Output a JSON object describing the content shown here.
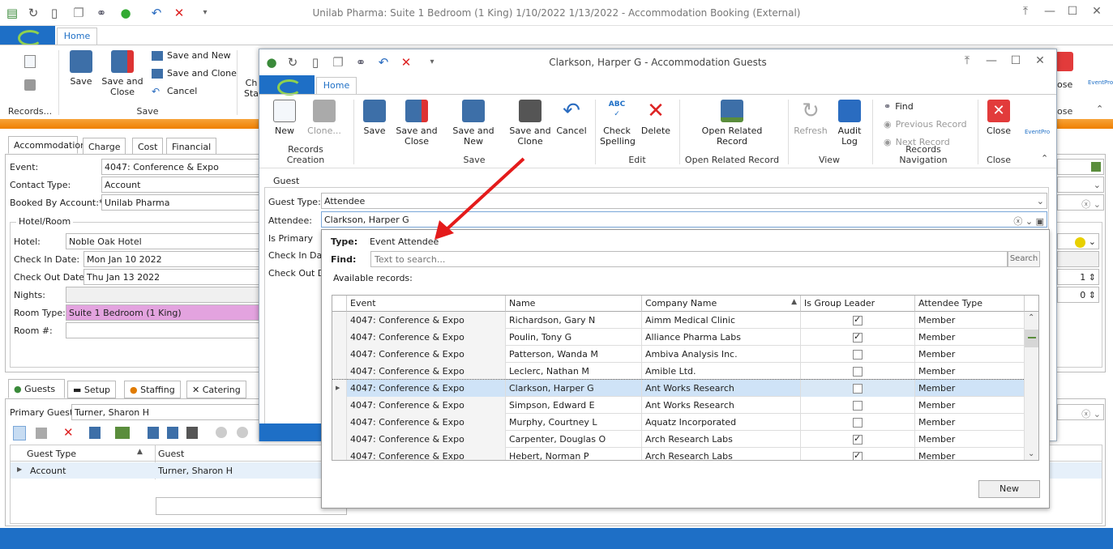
{
  "main_window": {
    "title": "Unilab Pharma: Suite 1 Bedroom (1 King) 1/10/2022 1/13/2022  - Accommodation Booking (External)",
    "home_tab": "Home"
  },
  "main_ribbon": {
    "save": "Save",
    "save_and_close": "Save and Close",
    "save_and_new": "Save and New",
    "save_and_clone": "Save and Clone",
    "cancel": "Cancel",
    "group_records": "Records...",
    "group_save": "Save",
    "partial_left": "Ch Sta",
    "partial_close": "ose",
    "partial_close_group": "ose",
    "partial_logo": "EventPro"
  },
  "booking_tabs": [
    "Accommodation",
    "Charge",
    "Cost",
    "Financial"
  ],
  "booking": {
    "event_label": "Event:",
    "event_value": "4047: Conference & Expo",
    "contact_type_label": "Contact Type:",
    "contact_type_value": "Account",
    "booked_by_label": "Booked By Account:*",
    "booked_by_value": "Unilab Pharma"
  },
  "hotel_room": {
    "section_title": "Hotel/Room",
    "hotel_label": "Hotel:",
    "hotel_value": "Noble Oak Hotel",
    "checkin_label": "Check In Date:",
    "checkin_value": "Mon Jan 10 2022",
    "checkout_label": "Check Out Date:",
    "checkout_value": "Thu Jan 13 2022",
    "nights_label": "Nights:",
    "nights_value": "",
    "room_type_label": "Room Type:",
    "room_type_value": "Suite 1 Bedroom (1 King)",
    "room_no_label": "Room #:",
    "room_no_value": "",
    "spin1": "1",
    "spin2": "0"
  },
  "bottom_tabs": [
    "Guests",
    "Setup",
    "Staffing",
    "Catering"
  ],
  "guests": {
    "primary_guest_label": "Primary Guest:",
    "primary_guest_value": "Turner, Sharon H",
    "col_guest_type": "Guest Type",
    "col_guest": "Guest",
    "row_type": "Account",
    "row_guest": "Turner, Sharon H"
  },
  "dialog": {
    "title": "Clarkson, Harper G - Accommodation Guests",
    "home_tab": "Home",
    "ribbon": {
      "new": "New",
      "clone": "Clone...",
      "save": "Save",
      "save_and_close": "Save and Close",
      "save_and_new": "Save and New",
      "save_and_clone": "Save and Clone",
      "cancel": "Cancel",
      "check_spelling": "Check Spelling",
      "abc": "ABC",
      "delete": "Delete",
      "open_related_record": "Open Related Record",
      "refresh": "Refresh",
      "audit_log": "Audit Log",
      "find": "Find",
      "previous_record": "Previous Record",
      "next_record": "Next Record",
      "close": "Close",
      "logo": "EventPro"
    },
    "groups": {
      "records_creation": "Records Creation",
      "save": "Save",
      "edit": "Edit",
      "open_related_record": "Open Related Record",
      "view": "View",
      "records_navigation": "Records Navigation",
      "close": "Close"
    },
    "guest_section": "Guest",
    "guest_type_label": "Guest Type:",
    "guest_type_value": "Attendee",
    "attendee_label": "Attendee:",
    "attendee_value": "Clarkson, Harper G",
    "is_primary_label": "Is Primary",
    "checkin_label": "Check In Date",
    "checkout_label": "Check Out Da"
  },
  "popup": {
    "type_label": "Type:",
    "type_value": "Event Attendee",
    "find_label": "Find:",
    "find_placeholder": "Text to search...",
    "search_button": "Search",
    "available_label": "Available records:",
    "new_button": "New",
    "columns": [
      "Event",
      "Name",
      "Company Name",
      "Is Group Leader",
      "Attendee Type"
    ],
    "rows": [
      {
        "event": "4047: Conference & Expo",
        "name": "Richardson, Gary N",
        "company": "Aimm Medical Clinic",
        "leader": true,
        "type": "Member"
      },
      {
        "event": "4047: Conference & Expo",
        "name": "Poulin, Tony G",
        "company": "Alliance Pharma Labs",
        "leader": true,
        "type": "Member"
      },
      {
        "event": "4047: Conference & Expo",
        "name": "Patterson, Wanda M",
        "company": "Ambiva Analysis Inc.",
        "leader": false,
        "type": "Member"
      },
      {
        "event": "4047: Conference & Expo",
        "name": "Leclerc, Nathan M",
        "company": "Amible Ltd.",
        "leader": false,
        "type": "Member"
      },
      {
        "event": "4047: Conference & Expo",
        "name": "Clarkson, Harper G",
        "company": "Ant Works Research",
        "leader": false,
        "type": "Member"
      },
      {
        "event": "4047: Conference & Expo",
        "name": "Simpson, Edward E",
        "company": "Ant Works Research",
        "leader": false,
        "type": "Member"
      },
      {
        "event": "4047: Conference & Expo",
        "name": "Murphy, Courtney L",
        "company": "Aquatz Incorporated",
        "leader": false,
        "type": "Member"
      },
      {
        "event": "4047: Conference & Expo",
        "name": "Carpenter, Douglas O",
        "company": "Arch Research Labs",
        "leader": true,
        "type": "Member"
      },
      {
        "event": "4047: Conference & Expo",
        "name": "Hebert, Norman P",
        "company": "Arch Research Labs",
        "leader": true,
        "type": "Member"
      }
    ]
  },
  "colors": {
    "accent": "#1e6fc6",
    "orange": "#ef7f00",
    "room_type_bg": "#e3a3df",
    "selected_row": "#cfe3f7",
    "arrow": "#e41b1b"
  }
}
